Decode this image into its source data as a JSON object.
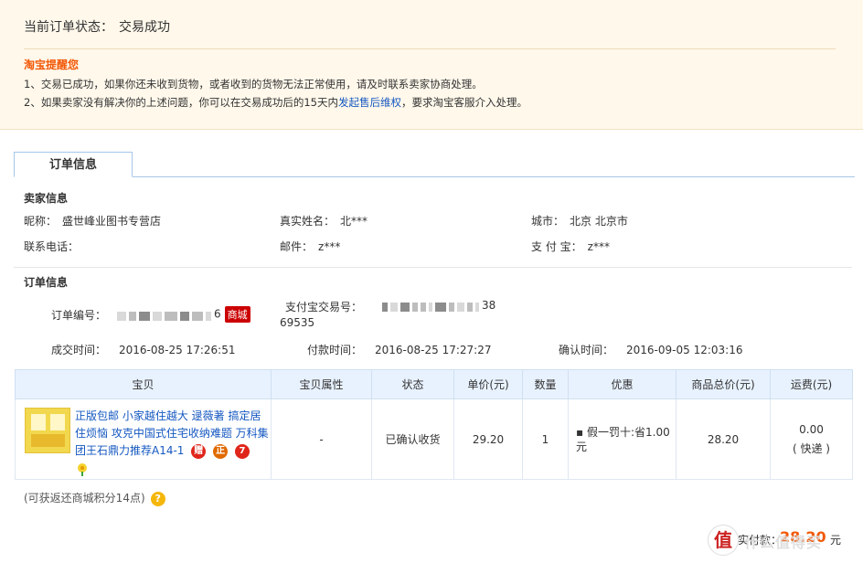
{
  "status": {
    "label": "当前订单状态：",
    "value": "交易成功"
  },
  "reminder": {
    "title": "淘宝提醒您",
    "line1": "1、交易已成功，如果你还未收到货物，或者收到的货物无法正常使用，请及时联系卖家协商处理。",
    "line2_prefix": "2、如果卖家没有解决你的上述问题，你可以在交易成功后的15天内",
    "line2_link": "发起售后维权",
    "line2_suffix": "，要求淘宝客服介入处理。"
  },
  "tabs": [
    "订单信息"
  ],
  "seller": {
    "section_title": "卖家信息",
    "nickname_label": "昵称：",
    "nickname": "盛世峰业图书专营店",
    "realname_label": "真实姓名：",
    "realname": "北***",
    "city_label": "城市：",
    "city": "北京 北京市",
    "phone_label": "联系电话：",
    "phone": "",
    "email_label": "邮件：",
    "email": "z***",
    "alipay_label": "支 付 宝：",
    "alipay": "z***"
  },
  "order": {
    "section_title": "订单信息",
    "order_no_label": "订单编号：",
    "order_no_tail": "6",
    "mall_badge": "商城",
    "alipay_no_label": "支付宝交易号：",
    "alipay_no_tail1": "38",
    "alipay_no_line2": "69535",
    "deal_time_label": "成交时间：",
    "deal_time": "2016-08-25 17:26:51",
    "pay_time_label": "付款时间：",
    "pay_time": "2016-08-25 17:27:27",
    "confirm_time_label": "确认时间：",
    "confirm_time": "2016-09-05 12:03:16"
  },
  "table": {
    "headers": [
      "宝贝",
      "宝贝属性",
      "状态",
      "单价(元)",
      "数量",
      "优惠",
      "商品总价(元)",
      "运费(元)"
    ],
    "row": {
      "title": "正版包邮 小家越住越大 逯薇著 搞定居住烦恼 攻克中国式住宅收纳难题 万科集团王石鼎力推荐A14-1",
      "icons": [
        "赠",
        "正",
        "7"
      ],
      "attr": "-",
      "status": "已确认收货",
      "unit_price": "29.20",
      "qty": "1",
      "promo_line1": "假一罚十:省1.00",
      "promo_line2": "元",
      "total": "28.20",
      "shipping": "0.00",
      "shipping_note": "( 快递 )"
    }
  },
  "points": {
    "text": "(可获返还商城积分14点)",
    "help_icon": "?"
  },
  "payment": {
    "label": "实付款：",
    "amount": "28.20",
    "unit": "元"
  },
  "watermark": {
    "glyph": "值",
    "text": "什么值得买"
  },
  "colors": {
    "accent": "#f25807",
    "link": "#1558c0",
    "reminder_bg": "#fff8eb",
    "table_header_bg": "#e8f2ff",
    "mall_badge": "#cc0000"
  }
}
